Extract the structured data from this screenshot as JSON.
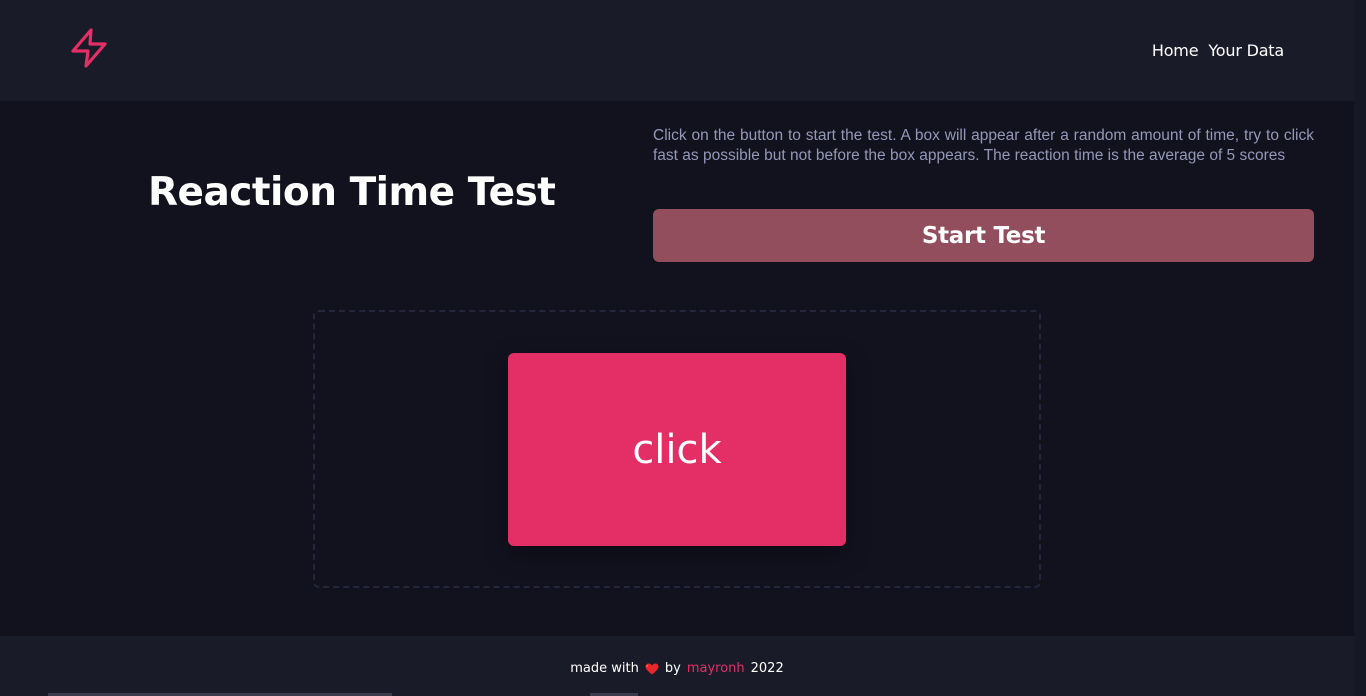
{
  "header": {
    "logo_icon": "lightning-bolt-icon",
    "nav": [
      {
        "label": "Home"
      },
      {
        "label": "Your Data"
      }
    ]
  },
  "main": {
    "title": "Reaction Time Test",
    "description": "Click on the button to start the test. A box will appear after a random amount of time, try to click fast as possible but not before the box appears. The reaction time is the average of 5 scores",
    "start_button_label": "Start Test",
    "click_box_label": "click"
  },
  "footer": {
    "made_with": "made with",
    "heart_icon": "heart-icon",
    "by": "by",
    "author": "mayronh",
    "year": "2022"
  },
  "colors": {
    "background": "#11121e",
    "header_footer": "#191b29",
    "accent": "#e42f66",
    "button_muted": "#934e5e",
    "description_text": "#9598b5"
  }
}
